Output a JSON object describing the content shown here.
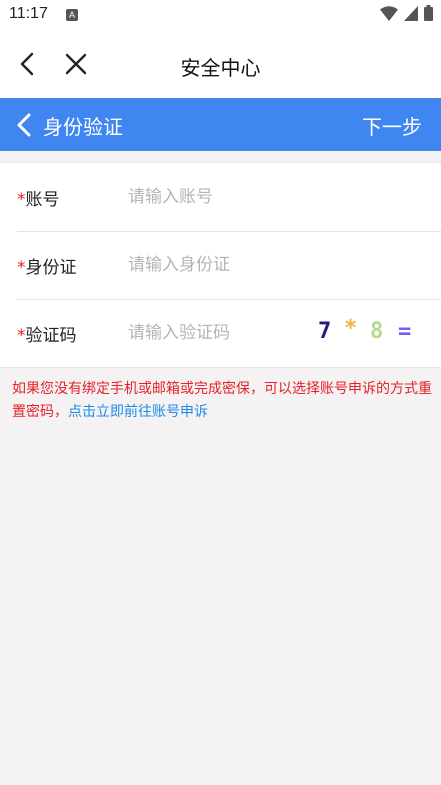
{
  "status_bar": {
    "time": "11:17",
    "notification_letter": "A"
  },
  "nav": {
    "title": "安全中心"
  },
  "header": {
    "title": "身份验证",
    "next_label": "下一步",
    "color": "#3f86f0"
  },
  "form": {
    "required_mark": "*",
    "account": {
      "label": "账号",
      "placeholder": "请输入账号",
      "value": ""
    },
    "id_card": {
      "label": "身份证",
      "placeholder": "请输入身份证",
      "value": ""
    },
    "captcha": {
      "label": "验证码",
      "placeholder": "请输入验证码",
      "value": "",
      "chars": [
        {
          "text": "7",
          "color": "#2b1a7a"
        },
        {
          "text": "*",
          "color": "#f2b43c"
        },
        {
          "text": "8",
          "color": "#b9d98a"
        },
        {
          "text": "=",
          "color": "#7a5cf0"
        }
      ]
    }
  },
  "notice": {
    "text": "如果您没有绑定手机或邮箱或完成密保，可以选择账号申诉的方式重置密码，",
    "link": "点击立即前往账号申诉",
    "text_color": "#e6212a",
    "link_color": "#1e8ae8"
  }
}
